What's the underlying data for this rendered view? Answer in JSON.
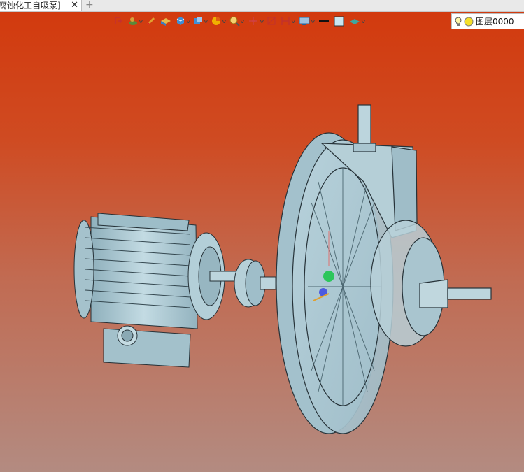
{
  "tab": {
    "title": "腐蚀化工自吸泵]",
    "close_glyph": "✕",
    "add_glyph": "+"
  },
  "toolbar": {
    "tools": [
      "frame-tool",
      "duck-tool",
      "pen-tool",
      "box-tool",
      "cube-tool",
      "view-cube-tool",
      "color-wheel-tool",
      "zoom-tool",
      "axes-tool",
      "section-tool",
      "measure-tool",
      "display-mode-tool",
      "line-color-tool",
      "fill-color-tool",
      "layer-material-tool"
    ],
    "layer": {
      "name": "图层0000"
    }
  },
  "colors": {
    "background_top": "#d23a0e",
    "background_bottom": "#b38b81",
    "model": "#a9c6d0",
    "model_dark": "#5f7f8b"
  }
}
